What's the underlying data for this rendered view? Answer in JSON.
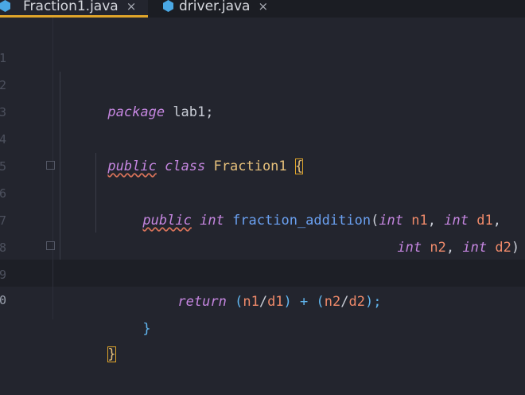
{
  "tabs": [
    {
      "label": "Fraction1.java",
      "close": "×",
      "active": true
    },
    {
      "label": "driver.java",
      "close": "×",
      "active": false
    }
  ],
  "line_numbers": [
    "1",
    "2",
    "3",
    "4",
    "5",
    "6",
    "7",
    "8",
    "9",
    "0"
  ],
  "code": {
    "l1": {
      "kw": "package",
      "rest": " lab1;"
    },
    "l3": {
      "kw1": "public",
      "kw2": "class",
      "cls": "Fraction1",
      "brace": "{"
    },
    "l5": {
      "kw1": "public",
      "t1": "int",
      "fn": "fraction_addition",
      "p0": "(",
      "t2": "int",
      "p1": "n1",
      "c1": ", ",
      "t3": "int",
      "p2": "d1",
      "c2": ","
    },
    "l6": {
      "t1": "int",
      "p1": "n2",
      "c1": ", ",
      "t2": "int",
      "p2": "d2",
      "tail": ") ",
      "brace": "{"
    },
    "l8": {
      "kw": "return",
      "e0": " (",
      "a": "n1",
      "e1": "/",
      "b": "d1",
      "e2": ") + (",
      "c": "n2",
      "e3": "/",
      "d": "d2",
      "e4": ");"
    },
    "l9": {
      "brace": "}"
    },
    "l10": {
      "brace": "}"
    }
  },
  "colors": {
    "keyword": "#c586e0",
    "class": "#e6c07b",
    "function": "#6aa0f0",
    "parameter": "#ef8a6a",
    "active_tab_underline": "#e0a52a",
    "java_icon": "#4aa8e4"
  },
  "icons": {
    "file_type": "java-file-icon",
    "close": "close-icon",
    "fold": "fold-marker-icon"
  }
}
